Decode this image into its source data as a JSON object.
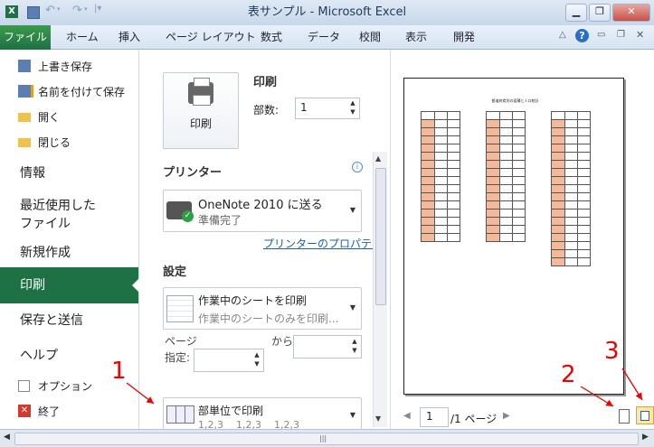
{
  "window": {
    "title": "表サンプル - Microsoft Excel",
    "qat_icons": [
      "excel-logo-icon",
      "save-icon",
      "undo-icon",
      "redo-icon",
      "qat-customize-icon"
    ],
    "controls": [
      "minimize-icon",
      "restore-icon",
      "close-icon"
    ],
    "ribbon_controls": [
      "ribbon-minimize-icon",
      "help-icon",
      "doc-minimize-icon",
      "doc-restore-icon",
      "doc-close-icon"
    ]
  },
  "ribbon": {
    "file_tab": "ファイル",
    "tabs": [
      "ホーム",
      "挿入",
      "ページ レイアウト",
      "数式",
      "データ",
      "校閲",
      "表示",
      "開発"
    ]
  },
  "backstage": {
    "small_items": [
      {
        "label": "上書き保存",
        "icon": "save-icon"
      },
      {
        "label": "名前を付けて保存",
        "icon": "save-as-icon"
      },
      {
        "label": "開く",
        "icon": "open-folder-icon"
      },
      {
        "label": "閉じる",
        "icon": "close-folder-icon"
      }
    ],
    "info": "情報",
    "recent_line1": "最近使用した",
    "recent_line2": "ファイル",
    "new": "新規作成",
    "print": "印刷",
    "save_send": "保存と送信",
    "help": "ヘルプ",
    "options": "オプション",
    "exit": "終了"
  },
  "print_panel": {
    "heading": "印刷",
    "print_button": "印刷",
    "copies_label": "部数:",
    "copies_value": "1",
    "printer_heading": "プリンター",
    "printer_name": "OneNote 2010 に送る",
    "printer_status": "準備完了",
    "printer_props": "プリンターのプロパティ",
    "settings_heading": "設定",
    "scope_title": "作業中のシートを印刷",
    "scope_sub": "作業中のシートのみを印刷...",
    "pages_label_1": "ページ",
    "pages_label_2": "指定:",
    "pages_from": "",
    "pages_to_label": "から",
    "pages_to": "",
    "collate_title": "部単位で印刷",
    "collate_sub": "1,2,3    1,2,3    1,2,3"
  },
  "preview": {
    "sheet_title": "都道府県別の面積と人口統計",
    "page_input": "1",
    "page_total": "/1 ページ",
    "show_margins_icon": "show-margins-icon",
    "zoom_page_icon": "zoom-to-page-icon"
  },
  "annotations": {
    "a1": "1",
    "a2": "2",
    "a3": "3"
  },
  "colors": {
    "file_green": "#1e7145",
    "annotation_red": "#e00000",
    "table_header_fill": "#f4b89a"
  }
}
